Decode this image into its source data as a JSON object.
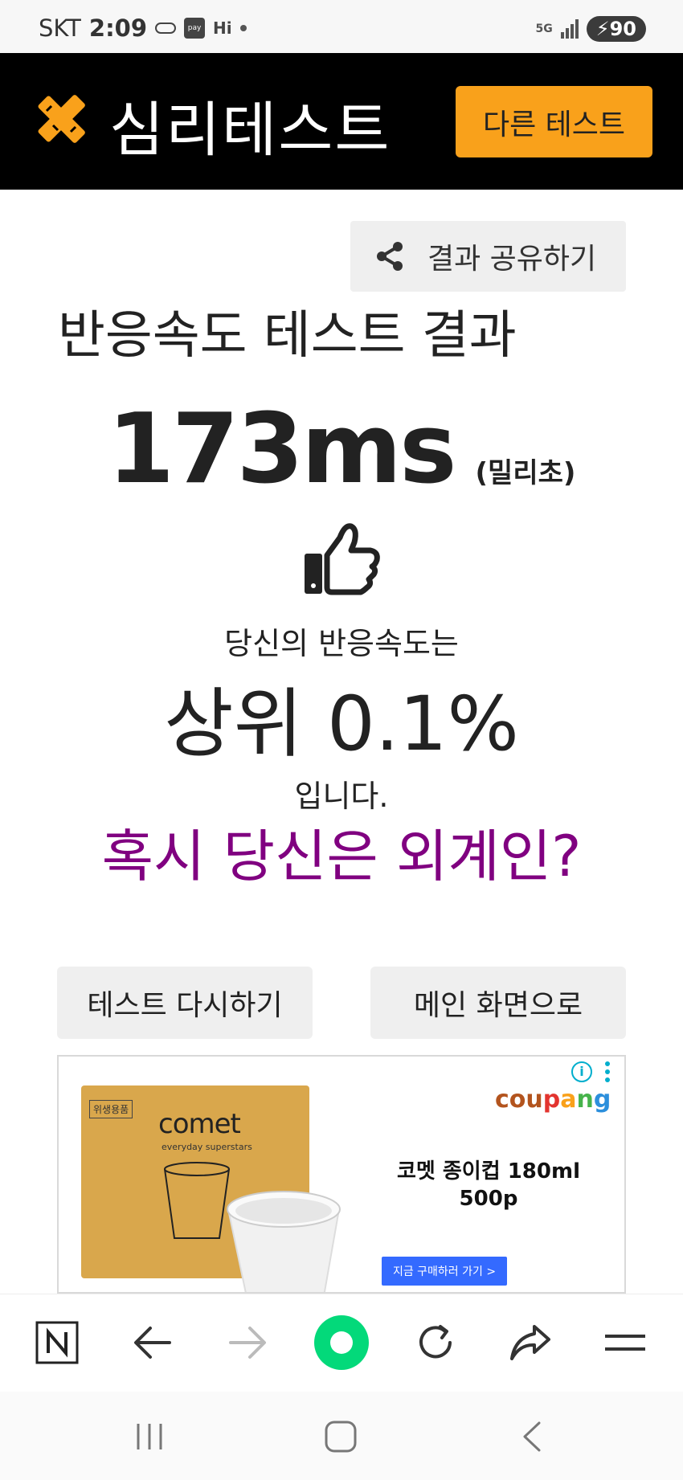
{
  "status_bar": {
    "carrier": "SKT",
    "time": "2:09",
    "network": "5G",
    "battery": "90",
    "hi_label": "Hi",
    "pay_label": "pay"
  },
  "header": {
    "logo_text": "심리테스트",
    "other_test_label": "다른 테스트"
  },
  "share": {
    "label": "결과 공유하기"
  },
  "result": {
    "title": "반응속도 테스트 결과",
    "score": "173ms",
    "unit": "(밀리초)",
    "desc_before": "당신의 반응속도는",
    "rank": "상위 0.1%",
    "desc_after": "입니다.",
    "alien_text": "혹시 당신은 외계인?"
  },
  "actions": {
    "retry_label": "테스트 다시하기",
    "main_label": "메인 화면으로"
  },
  "ad": {
    "box_tag": "위생용품",
    "box_brand": "comet",
    "box_sub": "everyday superstars",
    "coupang_letters": [
      "cou",
      "p",
      "a",
      "n",
      "g"
    ],
    "product_name": "코멧 종이컵 180ml 500p",
    "cta_label": "지금 구매하러 가기 >",
    "info_label": "i"
  },
  "colors": {
    "header_bg": "#000000",
    "accent": "#f9a11b",
    "alien_text": "#800080",
    "button_bg": "#efefef",
    "cta_bg": "#346aff"
  },
  "icons": {
    "logo": "pencil-ruler-icon",
    "share": "share-icon",
    "thumb": "thumbs-up-icon",
    "toolbar": [
      "naver-n-icon",
      "back-arrow-icon",
      "forward-arrow-icon",
      "green-dot-icon",
      "refresh-icon",
      "share-arrow-icon",
      "menu-icon"
    ],
    "navbar": [
      "recent-apps-icon",
      "home-icon",
      "back-icon"
    ]
  }
}
